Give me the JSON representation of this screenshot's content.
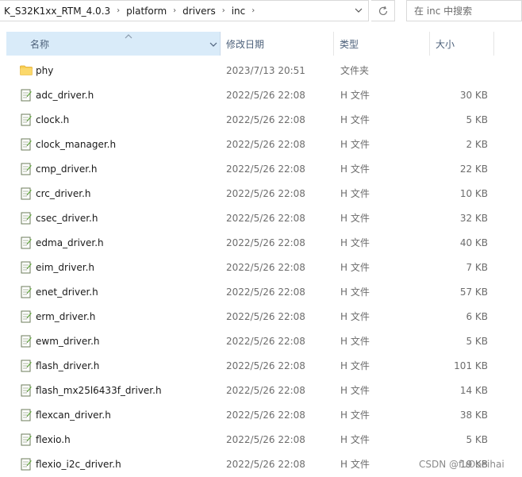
{
  "address": {
    "crumbs": [
      "K_S32K1xx_RTM_4.0.3",
      "platform",
      "drivers",
      "inc"
    ],
    "separator": "›"
  },
  "search": {
    "placeholder": "在 inc 中搜索"
  },
  "columns": {
    "name": "名称",
    "date": "修改日期",
    "type": "类型",
    "size": "大小"
  },
  "files": [
    {
      "name": "phy",
      "date": "2023/7/13 20:51",
      "type": "文件夹",
      "size": "",
      "icon": "folder-icon"
    },
    {
      "name": "adc_driver.h",
      "date": "2022/5/26 22:08",
      "type": "H 文件",
      "size": "30 KB",
      "icon": "h-file-icon"
    },
    {
      "name": "clock.h",
      "date": "2022/5/26 22:08",
      "type": "H 文件",
      "size": "5 KB",
      "icon": "h-file-icon"
    },
    {
      "name": "clock_manager.h",
      "date": "2022/5/26 22:08",
      "type": "H 文件",
      "size": "2 KB",
      "icon": "h-file-icon"
    },
    {
      "name": "cmp_driver.h",
      "date": "2022/5/26 22:08",
      "type": "H 文件",
      "size": "22 KB",
      "icon": "h-file-icon"
    },
    {
      "name": "crc_driver.h",
      "date": "2022/5/26 22:08",
      "type": "H 文件",
      "size": "10 KB",
      "icon": "h-file-icon"
    },
    {
      "name": "csec_driver.h",
      "date": "2022/5/26 22:08",
      "type": "H 文件",
      "size": "32 KB",
      "icon": "h-file-icon"
    },
    {
      "name": "edma_driver.h",
      "date": "2022/5/26 22:08",
      "type": "H 文件",
      "size": "40 KB",
      "icon": "h-file-icon"
    },
    {
      "name": "eim_driver.h",
      "date": "2022/5/26 22:08",
      "type": "H 文件",
      "size": "7 KB",
      "icon": "h-file-icon"
    },
    {
      "name": "enet_driver.h",
      "date": "2022/5/26 22:08",
      "type": "H 文件",
      "size": "57 KB",
      "icon": "h-file-icon"
    },
    {
      "name": "erm_driver.h",
      "date": "2022/5/26 22:08",
      "type": "H 文件",
      "size": "6 KB",
      "icon": "h-file-icon"
    },
    {
      "name": "ewm_driver.h",
      "date": "2022/5/26 22:08",
      "type": "H 文件",
      "size": "5 KB",
      "icon": "h-file-icon"
    },
    {
      "name": "flash_driver.h",
      "date": "2022/5/26 22:08",
      "type": "H 文件",
      "size": "101 KB",
      "icon": "h-file-icon"
    },
    {
      "name": "flash_mx25l6433f_driver.h",
      "date": "2022/5/26 22:08",
      "type": "H 文件",
      "size": "14 KB",
      "icon": "h-file-icon"
    },
    {
      "name": "flexcan_driver.h",
      "date": "2022/5/26 22:08",
      "type": "H 文件",
      "size": "38 KB",
      "icon": "h-file-icon"
    },
    {
      "name": "flexio.h",
      "date": "2022/5/26 22:08",
      "type": "H 文件",
      "size": "5 KB",
      "icon": "h-file-icon"
    },
    {
      "name": "flexio_i2c_driver.h",
      "date": "2022/5/26 22:08",
      "type": "H 文件",
      "size": "19 KB",
      "icon": "h-file-icon"
    }
  ],
  "watermark": "CSDN @fuOoeihai",
  "colors": {
    "header_selected": "#d9ebf9",
    "folder": "#f8cf53",
    "text_muted": "#6d6d6d"
  }
}
